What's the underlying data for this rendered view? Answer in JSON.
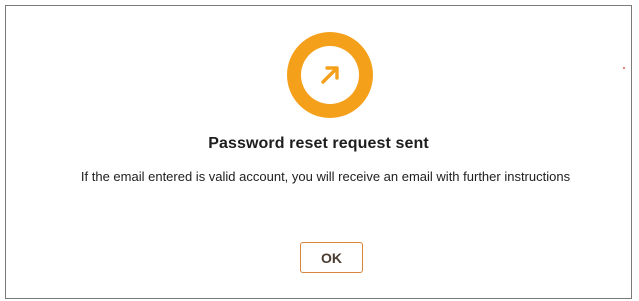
{
  "dialog": {
    "icon": "arrow-up-right-icon",
    "title": "Password reset request sent",
    "message": "If the email entered is valid account, you will receive an email with further instructions",
    "ok_label": "OK"
  },
  "colors": {
    "accent": "#f5a01a",
    "accent_dark": "#e8920f",
    "button_border": "#d8843a",
    "text": "#1e1e1e",
    "dialog_border": "#7a7a7a",
    "stray_dot": "#e05a5a"
  }
}
